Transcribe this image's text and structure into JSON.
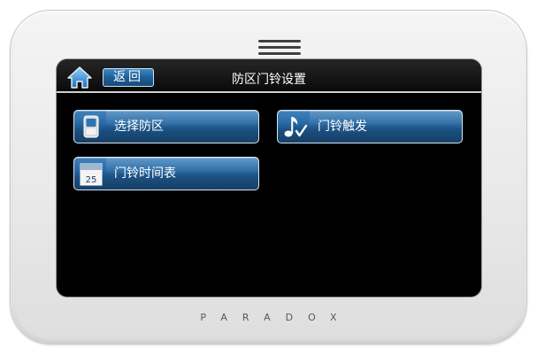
{
  "header": {
    "back_label": "返回",
    "title": "防区门铃设置",
    "home_icon": "home-icon"
  },
  "menu": {
    "items": [
      {
        "label": "选择防区",
        "icon": "keypad-device-icon"
      },
      {
        "label": "门铃触发",
        "icon": "music-note-check-icon"
      },
      {
        "label": "门铃时间表",
        "icon": "calendar-icon",
        "calendar_day": "25"
      }
    ]
  },
  "device": {
    "brand": "PARADOX"
  },
  "colors": {
    "button_blue": "#2a6ba5",
    "screen_bg": "#000000",
    "bezel": "#ececec"
  }
}
